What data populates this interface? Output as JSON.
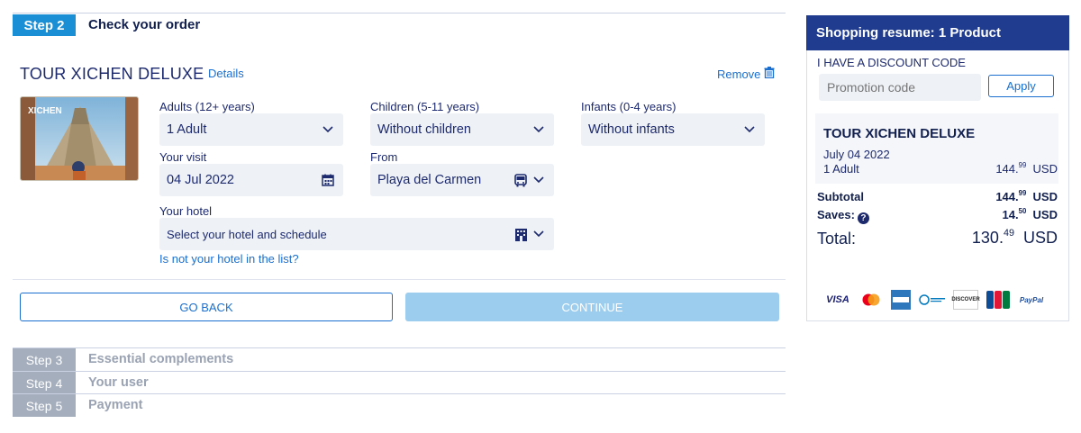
{
  "step2": {
    "number": "Step 2",
    "title": "Check your order"
  },
  "tour": {
    "title": "TOUR XICHEN DELUXE",
    "details_label": "Details",
    "remove_label": "Remove",
    "image_text": "XICHEN"
  },
  "form": {
    "adults": {
      "label": "Adults (12+ years)",
      "value": "1 Adult"
    },
    "children": {
      "label": "Children (5-11 years)",
      "value": "Without children"
    },
    "infants": {
      "label": "Infants (0-4 years)",
      "value": "Without infants"
    },
    "visit": {
      "label": "Your visit",
      "value": "04 Jul 2022"
    },
    "from": {
      "label": "From",
      "value": "Playa del Carmen"
    },
    "hotel": {
      "label": "Your hotel",
      "placeholder": "Select your hotel and schedule"
    },
    "hotel_link": "Is not your hotel in the list?"
  },
  "actions": {
    "back": "GO BACK",
    "continue": "CONTINUE"
  },
  "steps": [
    {
      "number": "Step 3",
      "label": "Essential complements"
    },
    {
      "number": "Step 4",
      "label": "Your user"
    },
    {
      "number": "Step 5",
      "label": "Payment"
    }
  ],
  "sidebar": {
    "title": "Shopping resume: 1 Product",
    "discount_label": "I HAVE A DISCOUNT CODE",
    "promo_placeholder": "Promotion code",
    "apply_label": "Apply",
    "product": {
      "title": "TOUR XICHEN DELUXE",
      "date": "July 04 2022",
      "qty": "1 Adult",
      "price_int": "144.",
      "price_dec": "99",
      "currency": "USD"
    },
    "subtotal": {
      "label": "Subtotal",
      "int": "144.",
      "dec": "99",
      "currency": "USD"
    },
    "saves": {
      "label": "Saves:",
      "int": "14.",
      "dec": "50",
      "currency": "USD"
    },
    "total": {
      "label": "Total:",
      "int": "130.",
      "dec": "49",
      "currency": "USD"
    },
    "payment_methods": [
      "VISA",
      "Mastercard",
      "American Express",
      "Diners Club",
      "DISCOVER",
      "JCB",
      "PayPal"
    ]
  },
  "colors": {
    "accent": "#1a8fd6",
    "header": "#1f3c8f",
    "link": "#1a6fcf",
    "continue_disabled": "#9ccdee",
    "step_inactive": "#a5aebd"
  }
}
